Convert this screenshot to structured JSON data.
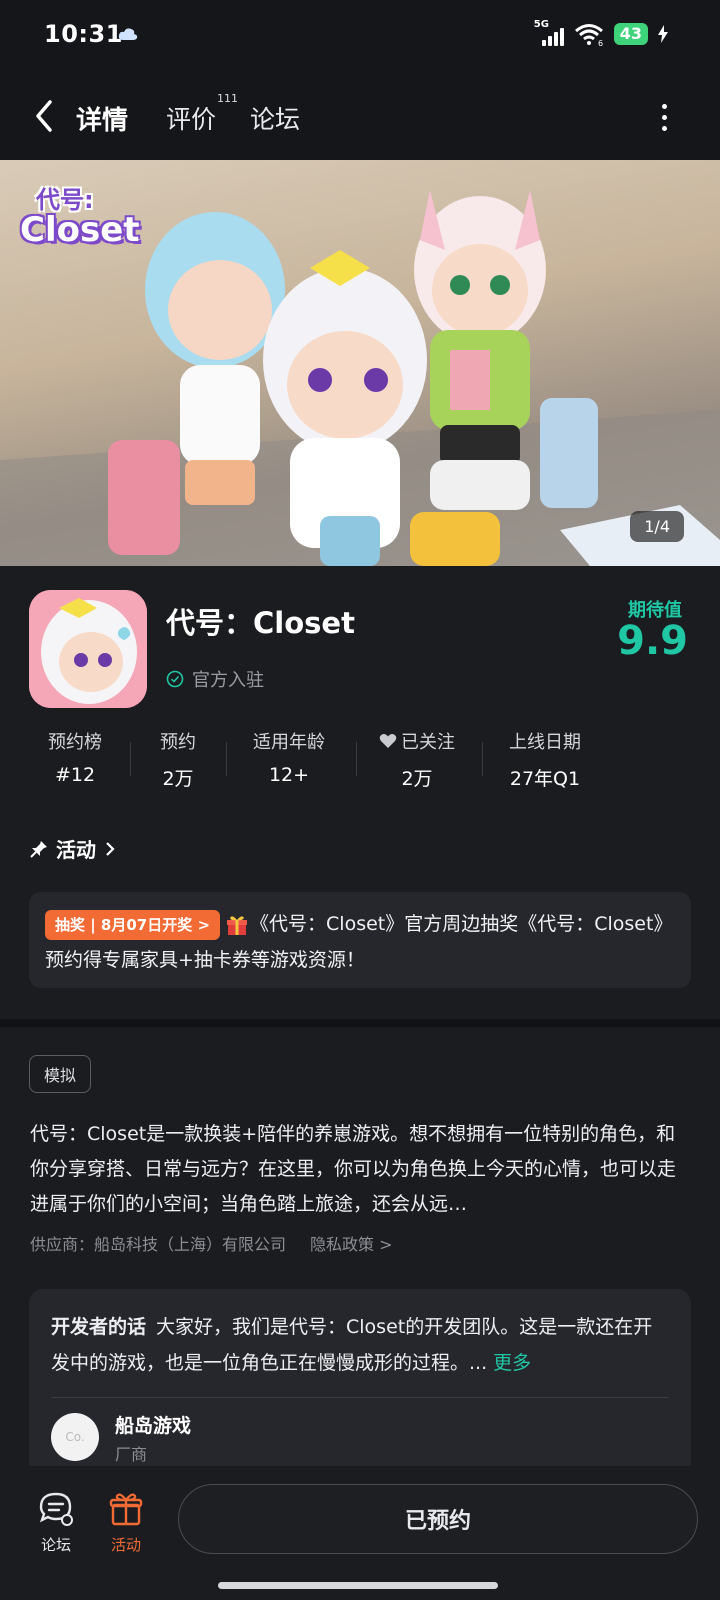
{
  "status_bar": {
    "time": "10:31",
    "network": "5G",
    "wifi_sub": "6",
    "battery": "43"
  },
  "nav": {
    "tabs": [
      {
        "label": "详情",
        "active": true
      },
      {
        "label": "评价",
        "badge": "111"
      },
      {
        "label": "论坛"
      }
    ]
  },
  "banner": {
    "logo_top": "代号:",
    "logo_bottom": "Closet",
    "counter": "1/4"
  },
  "app": {
    "name": "代号：Closet",
    "official": "官方入驻",
    "expect_label": "期待值",
    "expect_score": "9.9"
  },
  "stats": [
    {
      "label": "预约榜",
      "value": "#12"
    },
    {
      "label": "预约",
      "value": "2万"
    },
    {
      "label": "适用年龄",
      "value": "12+"
    },
    {
      "label": "已关注",
      "value": "2万"
    },
    {
      "label": "上线日期",
      "value": "27年Q1"
    }
  ],
  "activity": {
    "title": "活动",
    "tag": "抽奖 | 8月07日开奖 >",
    "text": "《代号：Closet》官方周边抽奖《代号：Closet》预约得专属家具+抽卡券等游戏资源！"
  },
  "description": {
    "genre_tag": "模拟",
    "text": "代号：Closet是一款换装+陪伴的养崽游戏。想不想拥有一位特别的角色，和你分享穿搭、日常与远方？在这里，你可以为角色换上今天的心情，也可以走进属于你们的小空间；当角色踏上旅途，还会从远…",
    "supplier": "供应商：船岛科技（上海）有限公司",
    "privacy": "隐私政策 >"
  },
  "developer": {
    "label": "开发者的话",
    "text": "大家好，我们是代号：Closet的开发团队。这是一款还在开发中的游戏，也是一位角色正在慢慢成形的过程。...",
    "more": "更多",
    "avatar_text": "Co.",
    "name": "船岛游戏",
    "role": "厂商"
  },
  "bottom_bar": {
    "forum": "论坛",
    "activity": "活动",
    "reserve_button": "已预约"
  },
  "colors": {
    "accent": "#1fc7a5",
    "orange": "#f26b35",
    "background": "#1b1c20"
  }
}
